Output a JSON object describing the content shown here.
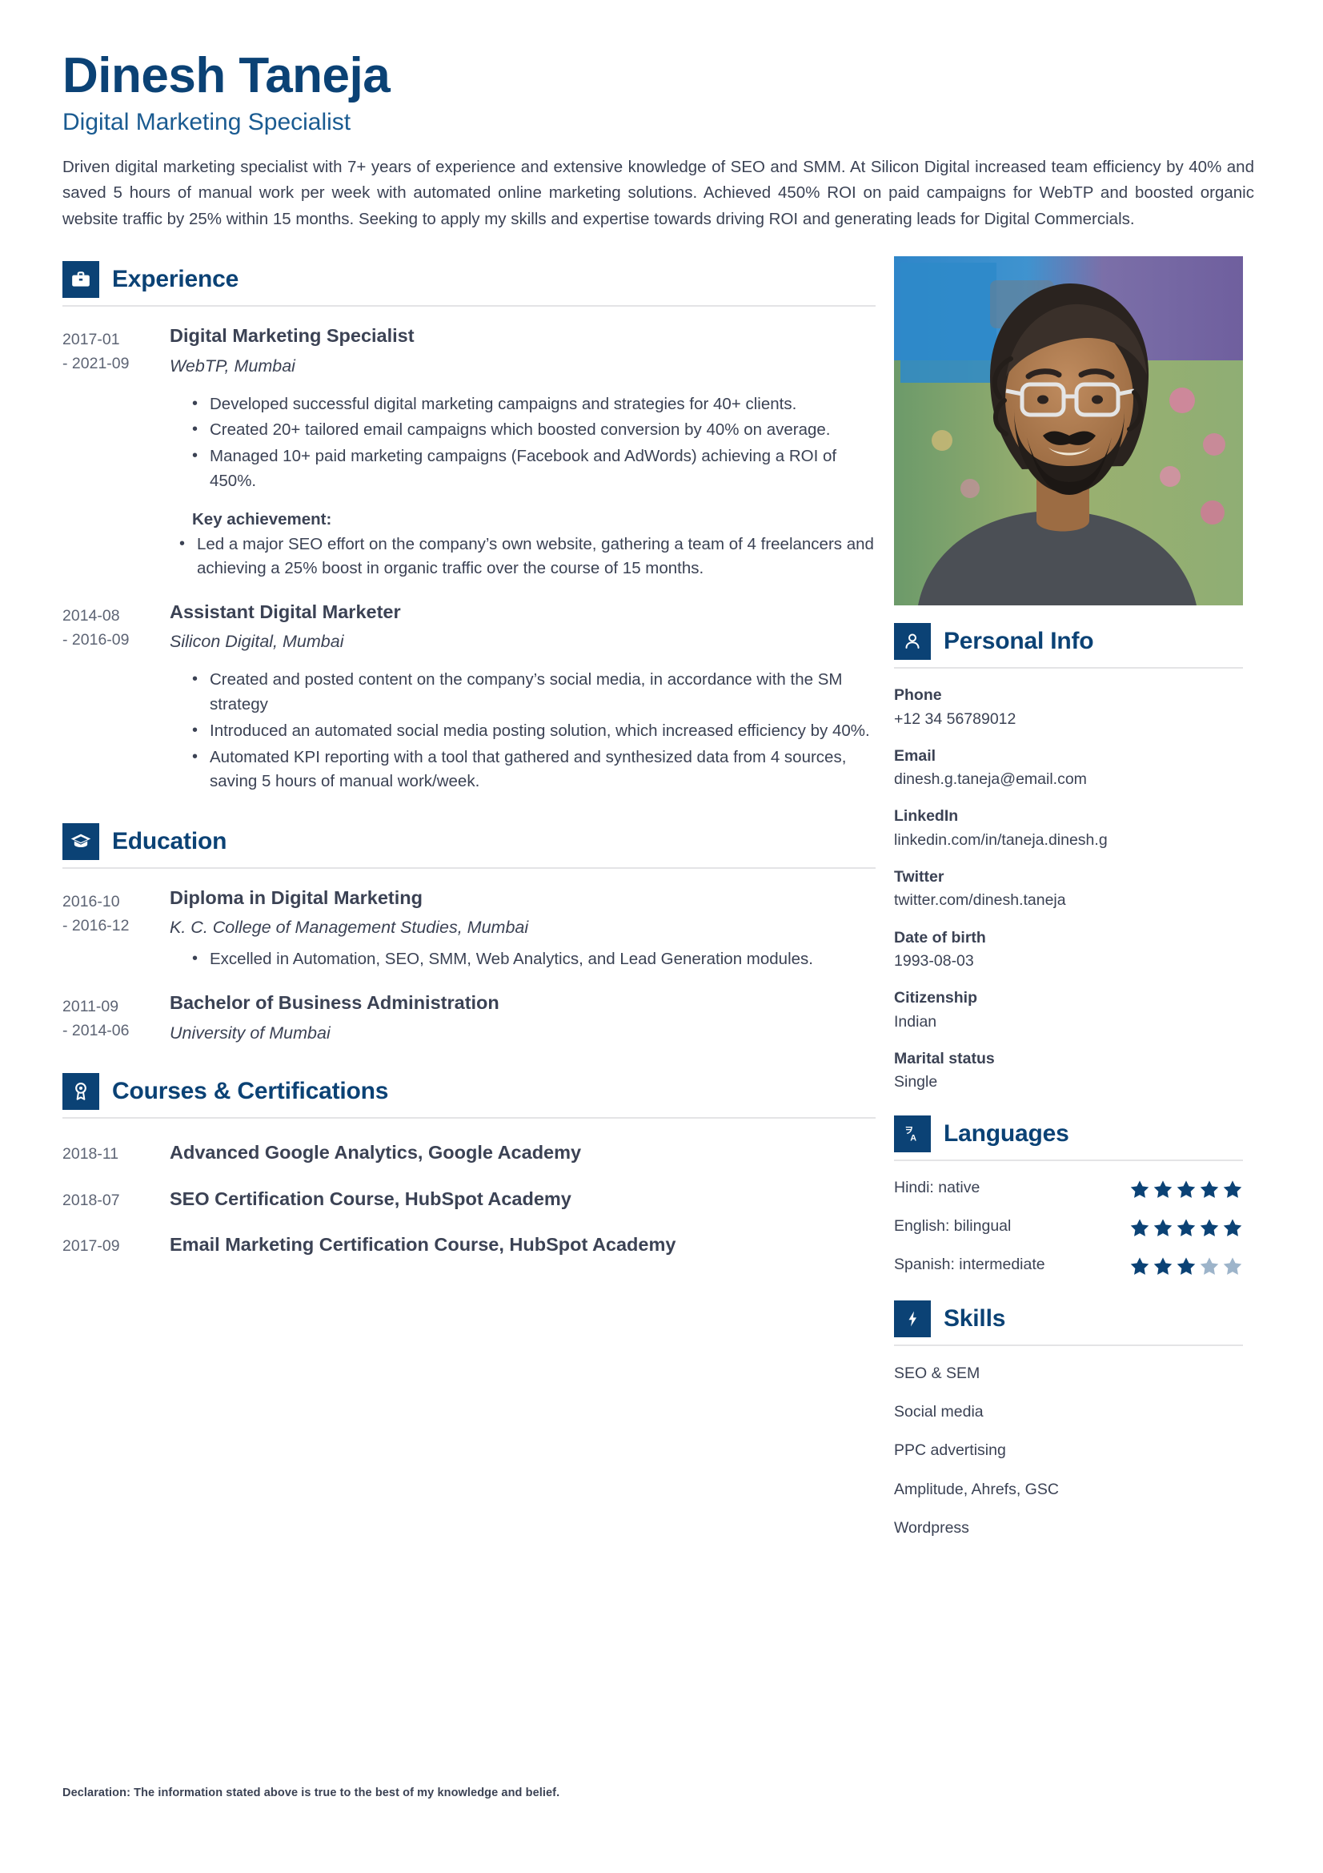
{
  "header": {
    "name": "Dinesh Taneja",
    "job_title": "Digital Marketing Specialist",
    "summary": "Driven digital marketing specialist with 7+ years of experience and extensive knowledge of SEO and SMM. At Silicon Digital increased team efficiency by 40% and saved 5 hours of manual work per week with automated online marketing solutions. Achieved 450% ROI on paid campaigns for WebTP and boosted organic website traffic by 25% within 15 months. Seeking to apply my skills and expertise towards driving ROI and generating leads for Digital Commercials."
  },
  "colors": {
    "accent": "#0b4275",
    "text": "#3b4254",
    "muted": "#5d6474",
    "rule": "#e4e4e6",
    "star_filled": "#0b4275",
    "star_empty": "#9db4ca"
  },
  "sections": {
    "experience": {
      "title": "Experience",
      "icon": "briefcase-icon",
      "entries": [
        {
          "date_start": "2017-01",
          "date_end": "- 2021-09",
          "title": "Digital Marketing Specialist",
          "org": "WebTP, Mumbai",
          "bullets": [
            "Developed successful digital marketing campaigns and strategies for 40+ clients.",
            "Created 20+ tailored email campaigns which boosted conversion by 40% on average.",
            "Managed 10+ paid marketing campaigns (Facebook and AdWords) achieving a ROI of 450%."
          ],
          "key_achievement_label": "Key achievement:",
          "key_achievement_bullets": [
            "Led a major SEO effort on the company’s own website, gathering a team of 4 freelancers and achieving a 25% boost in organic traffic over the course of 15 months."
          ]
        },
        {
          "date_start": "2014-08",
          "date_end": "- 2016-09",
          "title": "Assistant Digital Marketer",
          "org": "Silicon Digital, Mumbai",
          "bullets": [
            "Created and posted content on the company’s social media, in accordance with the SM strategy",
            "Introduced an automated social media posting solution, which increased efficiency by 40%.",
            "Automated KPI reporting with a tool that gathered and synthesized data from 4 sources, saving 5 hours of manual work/week."
          ]
        }
      ]
    },
    "education": {
      "title": "Education",
      "icon": "graduation-cap-icon",
      "entries": [
        {
          "date_start": "2016-10",
          "date_end": "- 2016-12",
          "title": "Diploma in Digital Marketing",
          "org": "K. C. College of Management Studies, Mumbai",
          "bullets": [
            "Excelled in Automation, SEO, SMM, Web Analytics, and Lead Generation modules."
          ]
        },
        {
          "date_start": "2011-09",
          "date_end": "- 2014-06",
          "title": "Bachelor of Business Administration",
          "org": "University of Mumbai",
          "bullets": []
        }
      ]
    },
    "courses": {
      "title": "Courses & Certifications",
      "icon": "award-ribbon-icon",
      "entries": [
        {
          "date": "2018-11",
          "name": "Advanced Google Analytics, Google Academy"
        },
        {
          "date": "2018-07",
          "name": "SEO Certification Course, HubSpot Academy"
        },
        {
          "date": "2017-09",
          "name": "Email Marketing Certification Course, HubSpot Academy"
        }
      ]
    }
  },
  "sidebar": {
    "photo_alt": "profile-photo",
    "personal_info": {
      "title": "Personal Info",
      "icon": "person-icon",
      "fields": [
        {
          "label": "Phone",
          "value": "+12 34 56789012"
        },
        {
          "label": "Email",
          "value": "dinesh.g.taneja@email.com"
        },
        {
          "label": "LinkedIn",
          "value": "linkedin.com/in/taneja.dinesh.g"
        },
        {
          "label": "Twitter",
          "value": "twitter.com/dinesh.taneja"
        },
        {
          "label": "Date of birth",
          "value": "1993-08-03"
        },
        {
          "label": "Citizenship",
          "value": "Indian"
        },
        {
          "label": "Marital status",
          "value": "Single"
        }
      ]
    },
    "languages": {
      "title": "Languages",
      "icon": "translate-icon",
      "max_stars": 5,
      "items": [
        {
          "name": "Hindi: native",
          "rating": 5
        },
        {
          "name": "English: bilingual",
          "rating": 5
        },
        {
          "name": "Spanish: intermediate",
          "rating": 3
        }
      ]
    },
    "skills": {
      "title": "Skills",
      "icon": "bolt-icon",
      "items": [
        "SEO & SEM",
        "Social media",
        "PPC advertising",
        "Amplitude, Ahrefs, GSC",
        "Wordpress"
      ]
    }
  },
  "footer": {
    "declaration": "Declaration: The information stated above is true to the best of my knowledge and belief."
  }
}
